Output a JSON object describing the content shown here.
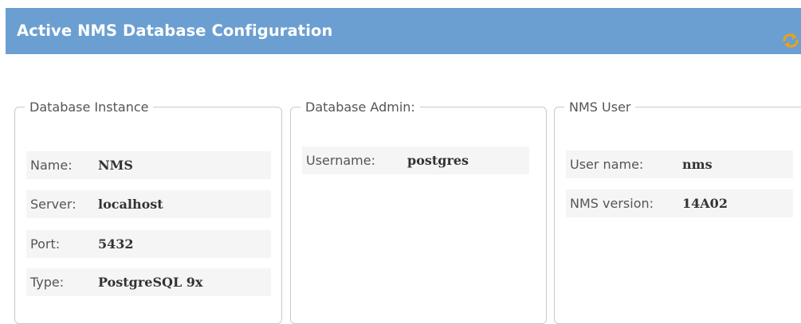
{
  "header": {
    "title": "Active NMS Database Configuration",
    "refresh_icon": "refresh-icon",
    "background": "#6b9fd1"
  },
  "database_instance": {
    "legend": "Database Instance",
    "fields": [
      {
        "label": "Name:",
        "value": "NMS"
      },
      {
        "label": "Server:",
        "value": "localhost"
      },
      {
        "label": "Port:",
        "value": "5432"
      },
      {
        "label": "Type:",
        "value": "PostgreSQL 9x"
      }
    ]
  },
  "database_admin": {
    "legend": "Database Admin:",
    "fields": [
      {
        "label": "Username:",
        "value": "postgres"
      }
    ]
  },
  "nms_user": {
    "legend": "NMS User",
    "fields": [
      {
        "label": "User name:",
        "value": "nms"
      },
      {
        "label": "NMS version:",
        "value": "14A02"
      }
    ]
  }
}
